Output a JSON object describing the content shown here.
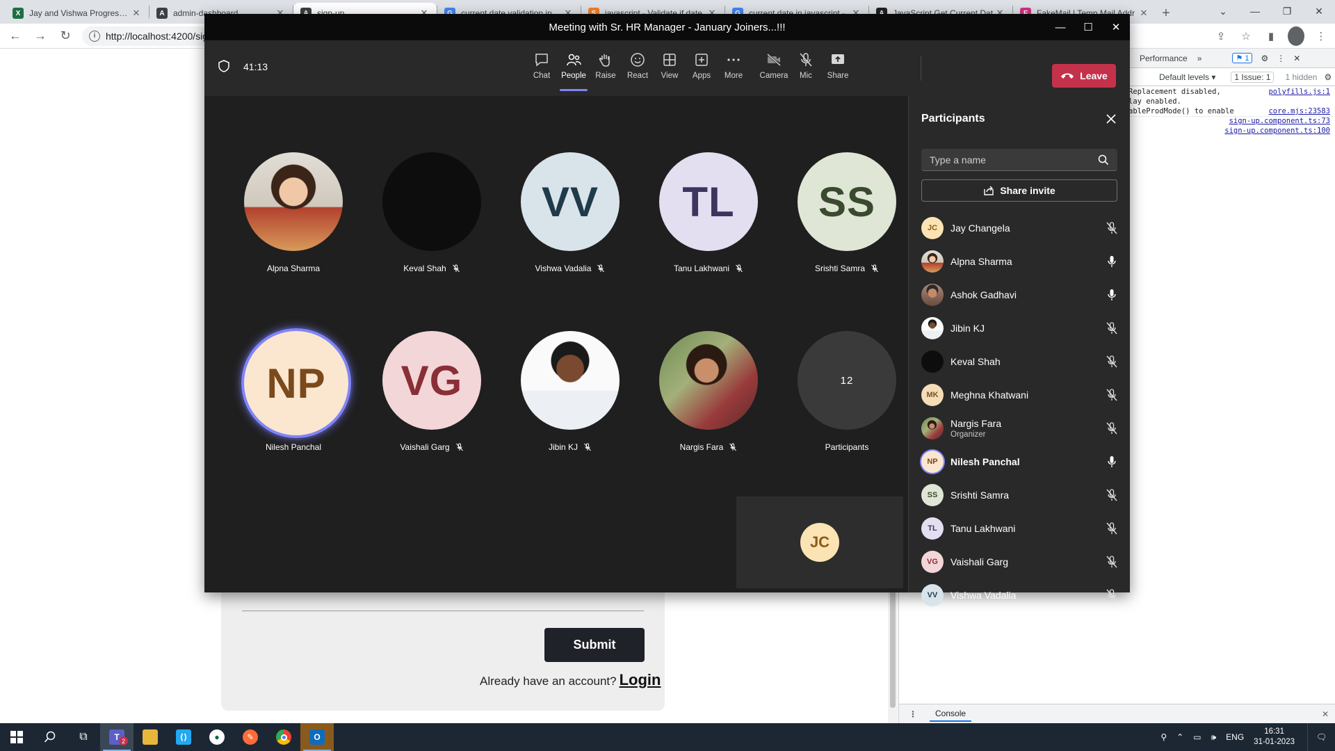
{
  "browser": {
    "tabs": [
      {
        "label": "Jay and Vishwa Progress.xl",
        "fav_color": "#1d6f42",
        "fav_text": "X",
        "active": false
      },
      {
        "label": "admin-dashboard",
        "fav_color": "#3c4043",
        "fav_text": "A",
        "active": false
      },
      {
        "label": "sign-up",
        "fav_color": "#3c4043",
        "fav_text": "A",
        "active": true
      },
      {
        "label": "current date validation in",
        "fav_color": "#4285f4",
        "fav_text": "G",
        "active": false
      },
      {
        "label": "javascript - Validate if date",
        "fav_color": "#f48024",
        "fav_text": "S",
        "active": false
      },
      {
        "label": "current date in javascript -",
        "fav_color": "#4285f4",
        "fav_text": "G",
        "active": false
      },
      {
        "label": "JavaScript Get Current Dat",
        "fav_color": "#222222",
        "fav_text": "A",
        "active": false
      },
      {
        "label": "FakeMail | Temp Mail Addr",
        "fav_color": "#d63384",
        "fav_text": "F",
        "active": false
      }
    ],
    "url": "http://localhost:4200/sig"
  },
  "page": {
    "submit_label": "Submit",
    "have_account": "Already have an account?",
    "login_label": "Login"
  },
  "devtools": {
    "panel_tab": "Performance",
    "badge": "1",
    "levels": "Default levels ▾",
    "issues": "1 Issue: 1",
    "hidden": "1 hidden",
    "log": [
      {
        "text": "Replacement disabled,",
        "src": "polyfills.js:1"
      },
      {
        "text": "lay enabled.",
        "src": ""
      },
      {
        "text": "ableProdMode() to enable",
        "src": "core.mjs:23583"
      },
      {
        "text": "",
        "src": "sign-up.component.ts:73"
      },
      {
        "text": "",
        "src": "sign-up.component.ts:100"
      }
    ],
    "drawer_tab": "Console"
  },
  "teams": {
    "window_title": "Meeting with Sr. HR Manager - January Joiners...!!!",
    "timer": "41:13",
    "toolbar": [
      {
        "label": "Chat",
        "icon": "chat-icon",
        "active": false
      },
      {
        "label": "People",
        "icon": "people-icon",
        "active": true
      },
      {
        "label": "Raise",
        "icon": "raise-hand-icon",
        "active": false
      },
      {
        "label": "React",
        "icon": "react-icon",
        "active": false
      },
      {
        "label": "View",
        "icon": "view-icon",
        "active": false
      },
      {
        "label": "Apps",
        "icon": "apps-icon",
        "active": false
      },
      {
        "label": "More",
        "icon": "more-icon",
        "active": false
      },
      {
        "label": "Camera",
        "icon": "camera-off-icon",
        "active": false
      },
      {
        "label": "Mic",
        "icon": "mic-off-icon",
        "active": false
      },
      {
        "label": "Share",
        "icon": "share-icon",
        "active": false
      }
    ],
    "leave_label": "Leave",
    "stage": [
      {
        "name": "Alpna Sharma",
        "initials": "",
        "bg": "photo-f",
        "fg": "#ffffff",
        "muted": false
      },
      {
        "name": "Keval Shah",
        "initials": "",
        "bg": "photo-k",
        "fg": "#ffffff",
        "muted": true
      },
      {
        "name": "Vishwa Vadalia",
        "initials": "VV",
        "bg": "#d9e4ea",
        "fg": "#1f3a4a",
        "muted": true
      },
      {
        "name": "Tanu Lakhwani",
        "initials": "TL",
        "bg": "#e3dff0",
        "fg": "#3d3560",
        "muted": true
      },
      {
        "name": "Srishti Samra",
        "initials": "SS",
        "bg": "#dfe6d6",
        "fg": "#3a4a2e",
        "muted": true
      },
      {
        "name": "Nilesh Panchal",
        "initials": "NP",
        "bg": "#fbe6d0",
        "fg": "#7a4a1c",
        "muted": false,
        "speaking": true
      },
      {
        "name": "Vaishali Garg",
        "initials": "VG",
        "bg": "#f3d6d8",
        "fg": "#8a2e37",
        "muted": true
      },
      {
        "name": "Jibin KJ",
        "initials": "",
        "bg": "photo-j",
        "fg": "#ffffff",
        "muted": true
      },
      {
        "name": "Nargis Fara",
        "initials": "",
        "bg": "photo-n",
        "fg": "#ffffff",
        "muted": true
      },
      {
        "name": "Participants",
        "initials": "12",
        "bg": "#3a3a3a",
        "fg": "#ffffff",
        "muted": false,
        "overflow": true
      }
    ],
    "self_initials": "JC",
    "panel": {
      "title": "Participants",
      "search_placeholder": "Type a name",
      "invite_label": "Share invite",
      "people": [
        {
          "name": "Jay Changela",
          "initials": "JC",
          "bg": "#fbe3b3",
          "fg": "#8a5a17",
          "mic": "off"
        },
        {
          "name": "Alpna Sharma",
          "initials": "",
          "bg": "photo-f",
          "fg": "#fff",
          "mic": "on"
        },
        {
          "name": "Ashok Gadhavi",
          "initials": "",
          "bg": "photo-a",
          "fg": "#fff",
          "mic": "on"
        },
        {
          "name": "Jibin KJ",
          "initials": "",
          "bg": "photo-j",
          "fg": "#fff",
          "mic": "off"
        },
        {
          "name": "Keval Shah",
          "initials": "",
          "bg": "photo-k",
          "fg": "#fff",
          "mic": "off"
        },
        {
          "name": "Meghna Khatwani",
          "initials": "MK",
          "bg": "#f5ddb8",
          "fg": "#7a5320",
          "mic": "off"
        },
        {
          "name": "Nargis Fara",
          "initials": "",
          "bg": "photo-n",
          "fg": "#fff",
          "mic": "off",
          "role": "Organizer"
        },
        {
          "name": "Nilesh Panchal",
          "initials": "NP",
          "bg": "#fbe6d0",
          "fg": "#7a4a1c",
          "mic": "on",
          "speaking": true
        },
        {
          "name": "Srishti Samra",
          "initials": "SS",
          "bg": "#dfe6d6",
          "fg": "#3a4a2e",
          "mic": "off"
        },
        {
          "name": "Tanu Lakhwani",
          "initials": "TL",
          "bg": "#e3dff0",
          "fg": "#3d3560",
          "mic": "off"
        },
        {
          "name": "Vaishali Garg",
          "initials": "VG",
          "bg": "#f3d6d8",
          "fg": "#8a2e37",
          "mic": "off"
        },
        {
          "name": "Vishwa Vadalia",
          "initials": "VV",
          "bg": "#d9e4ea",
          "fg": "#1f3a4a",
          "mic": "off"
        }
      ]
    }
  },
  "taskbar": {
    "teams_badge": "2",
    "lang": "ENG",
    "time": "16:31",
    "date": "31-01-2023"
  }
}
